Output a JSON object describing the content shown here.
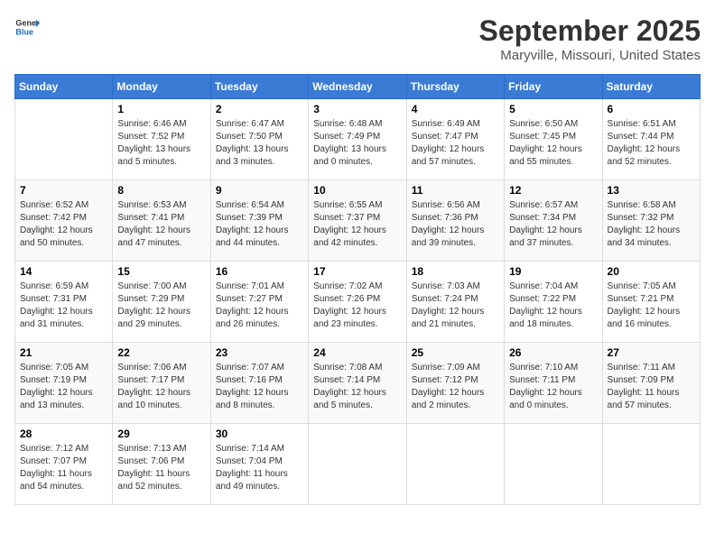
{
  "header": {
    "logo_line1": "General",
    "logo_line2": "Blue",
    "title": "September 2025",
    "subtitle": "Maryville, Missouri, United States"
  },
  "days_of_week": [
    "Sunday",
    "Monday",
    "Tuesday",
    "Wednesday",
    "Thursday",
    "Friday",
    "Saturday"
  ],
  "weeks": [
    [
      {
        "day": "",
        "info": ""
      },
      {
        "day": "1",
        "info": "Sunrise: 6:46 AM\nSunset: 7:52 PM\nDaylight: 13 hours\nand 5 minutes."
      },
      {
        "day": "2",
        "info": "Sunrise: 6:47 AM\nSunset: 7:50 PM\nDaylight: 13 hours\nand 3 minutes."
      },
      {
        "day": "3",
        "info": "Sunrise: 6:48 AM\nSunset: 7:49 PM\nDaylight: 13 hours\nand 0 minutes."
      },
      {
        "day": "4",
        "info": "Sunrise: 6:49 AM\nSunset: 7:47 PM\nDaylight: 12 hours\nand 57 minutes."
      },
      {
        "day": "5",
        "info": "Sunrise: 6:50 AM\nSunset: 7:45 PM\nDaylight: 12 hours\nand 55 minutes."
      },
      {
        "day": "6",
        "info": "Sunrise: 6:51 AM\nSunset: 7:44 PM\nDaylight: 12 hours\nand 52 minutes."
      }
    ],
    [
      {
        "day": "7",
        "info": "Sunrise: 6:52 AM\nSunset: 7:42 PM\nDaylight: 12 hours\nand 50 minutes."
      },
      {
        "day": "8",
        "info": "Sunrise: 6:53 AM\nSunset: 7:41 PM\nDaylight: 12 hours\nand 47 minutes."
      },
      {
        "day": "9",
        "info": "Sunrise: 6:54 AM\nSunset: 7:39 PM\nDaylight: 12 hours\nand 44 minutes."
      },
      {
        "day": "10",
        "info": "Sunrise: 6:55 AM\nSunset: 7:37 PM\nDaylight: 12 hours\nand 42 minutes."
      },
      {
        "day": "11",
        "info": "Sunrise: 6:56 AM\nSunset: 7:36 PM\nDaylight: 12 hours\nand 39 minutes."
      },
      {
        "day": "12",
        "info": "Sunrise: 6:57 AM\nSunset: 7:34 PM\nDaylight: 12 hours\nand 37 minutes."
      },
      {
        "day": "13",
        "info": "Sunrise: 6:58 AM\nSunset: 7:32 PM\nDaylight: 12 hours\nand 34 minutes."
      }
    ],
    [
      {
        "day": "14",
        "info": "Sunrise: 6:59 AM\nSunset: 7:31 PM\nDaylight: 12 hours\nand 31 minutes."
      },
      {
        "day": "15",
        "info": "Sunrise: 7:00 AM\nSunset: 7:29 PM\nDaylight: 12 hours\nand 29 minutes."
      },
      {
        "day": "16",
        "info": "Sunrise: 7:01 AM\nSunset: 7:27 PM\nDaylight: 12 hours\nand 26 minutes."
      },
      {
        "day": "17",
        "info": "Sunrise: 7:02 AM\nSunset: 7:26 PM\nDaylight: 12 hours\nand 23 minutes."
      },
      {
        "day": "18",
        "info": "Sunrise: 7:03 AM\nSunset: 7:24 PM\nDaylight: 12 hours\nand 21 minutes."
      },
      {
        "day": "19",
        "info": "Sunrise: 7:04 AM\nSunset: 7:22 PM\nDaylight: 12 hours\nand 18 minutes."
      },
      {
        "day": "20",
        "info": "Sunrise: 7:05 AM\nSunset: 7:21 PM\nDaylight: 12 hours\nand 16 minutes."
      }
    ],
    [
      {
        "day": "21",
        "info": "Sunrise: 7:05 AM\nSunset: 7:19 PM\nDaylight: 12 hours\nand 13 minutes."
      },
      {
        "day": "22",
        "info": "Sunrise: 7:06 AM\nSunset: 7:17 PM\nDaylight: 12 hours\nand 10 minutes."
      },
      {
        "day": "23",
        "info": "Sunrise: 7:07 AM\nSunset: 7:16 PM\nDaylight: 12 hours\nand 8 minutes."
      },
      {
        "day": "24",
        "info": "Sunrise: 7:08 AM\nSunset: 7:14 PM\nDaylight: 12 hours\nand 5 minutes."
      },
      {
        "day": "25",
        "info": "Sunrise: 7:09 AM\nSunset: 7:12 PM\nDaylight: 12 hours\nand 2 minutes."
      },
      {
        "day": "26",
        "info": "Sunrise: 7:10 AM\nSunset: 7:11 PM\nDaylight: 12 hours\nand 0 minutes."
      },
      {
        "day": "27",
        "info": "Sunrise: 7:11 AM\nSunset: 7:09 PM\nDaylight: 11 hours\nand 57 minutes."
      }
    ],
    [
      {
        "day": "28",
        "info": "Sunrise: 7:12 AM\nSunset: 7:07 PM\nDaylight: 11 hours\nand 54 minutes."
      },
      {
        "day": "29",
        "info": "Sunrise: 7:13 AM\nSunset: 7:06 PM\nDaylight: 11 hours\nand 52 minutes."
      },
      {
        "day": "30",
        "info": "Sunrise: 7:14 AM\nSunset: 7:04 PM\nDaylight: 11 hours\nand 49 minutes."
      },
      {
        "day": "",
        "info": ""
      },
      {
        "day": "",
        "info": ""
      },
      {
        "day": "",
        "info": ""
      },
      {
        "day": "",
        "info": ""
      }
    ]
  ]
}
